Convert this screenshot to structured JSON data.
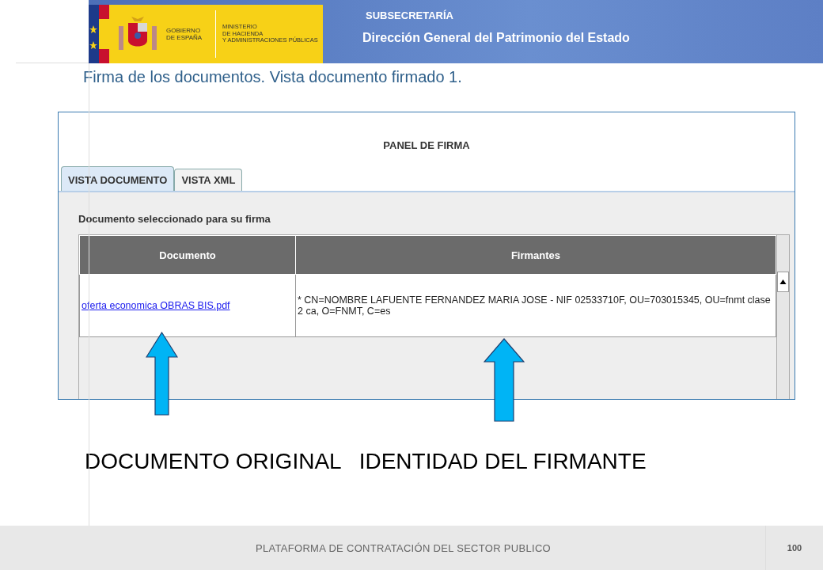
{
  "header": {
    "logo": {
      "government": [
        "GOBIERNO",
        "DE ESPAÑA"
      ],
      "ministry": [
        "MINISTERIO",
        "DE HACIENDA",
        "Y ADMINISTRACIONES PÚBLICAS"
      ]
    },
    "subsecretariat": "SUBSECRETARÍA",
    "directorate": "Dirección General del Patrimonio del Estado"
  },
  "slide_title": "Firma de los documentos. Vista documento firmado 1.",
  "panel": {
    "title": "PANEL DE FIRMA",
    "tabs": [
      {
        "label": "VISTA DOCUMENTO",
        "selected": true
      },
      {
        "label": "VISTA XML",
        "selected": false
      }
    ],
    "section_label": "Documento seleccionado para su firma",
    "table": {
      "columns": [
        "Documento",
        "Firmantes"
      ],
      "rows": [
        {
          "document": "oferta economica OBRAS BIS.pdf",
          "signers": "* CN=NOMBRE LAFUENTE FERNANDEZ MARIA JOSE - NIF 02533710F, OU=703015345, OU=fnmt clase 2 ca, O=FNMT, C=es"
        }
      ]
    }
  },
  "callouts": [
    "DOCUMENTO ORIGINAL",
    "IDENTIDAD DEL FIRMANTE"
  ],
  "footer": {
    "text": "PLATAFORMA DE CONTRATACIÓN DEL SECTOR PUBLICO",
    "page_number": "100"
  }
}
